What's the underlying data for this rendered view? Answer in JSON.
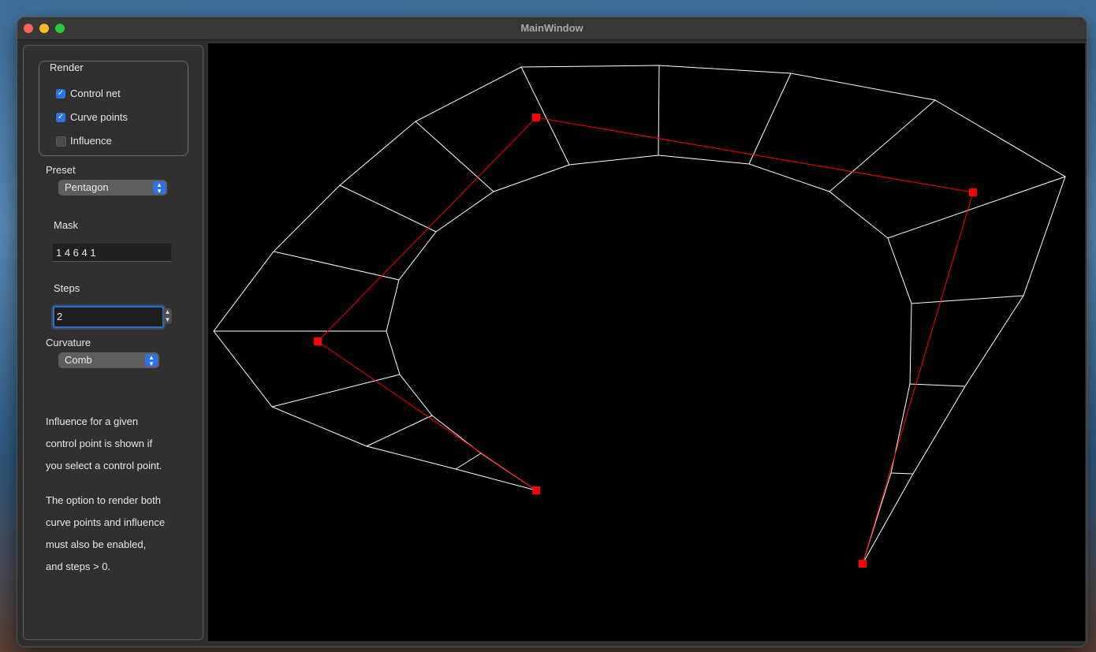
{
  "window": {
    "title": "MainWindow"
  },
  "sidebar": {
    "render_group": {
      "title": "Render",
      "checkboxes": [
        {
          "label": "Control net",
          "checked": true
        },
        {
          "label": "Curve points",
          "checked": true
        },
        {
          "label": "Influence",
          "checked": false
        }
      ]
    },
    "preset": {
      "label": "Preset",
      "value": "Pentagon"
    },
    "mask": {
      "label": "Mask",
      "value": "1 4 6 4 1"
    },
    "steps": {
      "label": "Steps",
      "value": "2"
    },
    "curvature": {
      "label": "Curvature",
      "value": "Comb"
    },
    "notes": [
      "Influence for a given",
      "control point is shown if",
      "you select a control point.",
      "The option to render both",
      "curve points and influence",
      "must also be enabled,",
      "and steps > 0."
    ]
  },
  "colors": {
    "control_net": "#ff0000",
    "curve": "#ffffff",
    "canvas_background": "#000000",
    "checkbox_accent": "#2b74e8"
  }
}
